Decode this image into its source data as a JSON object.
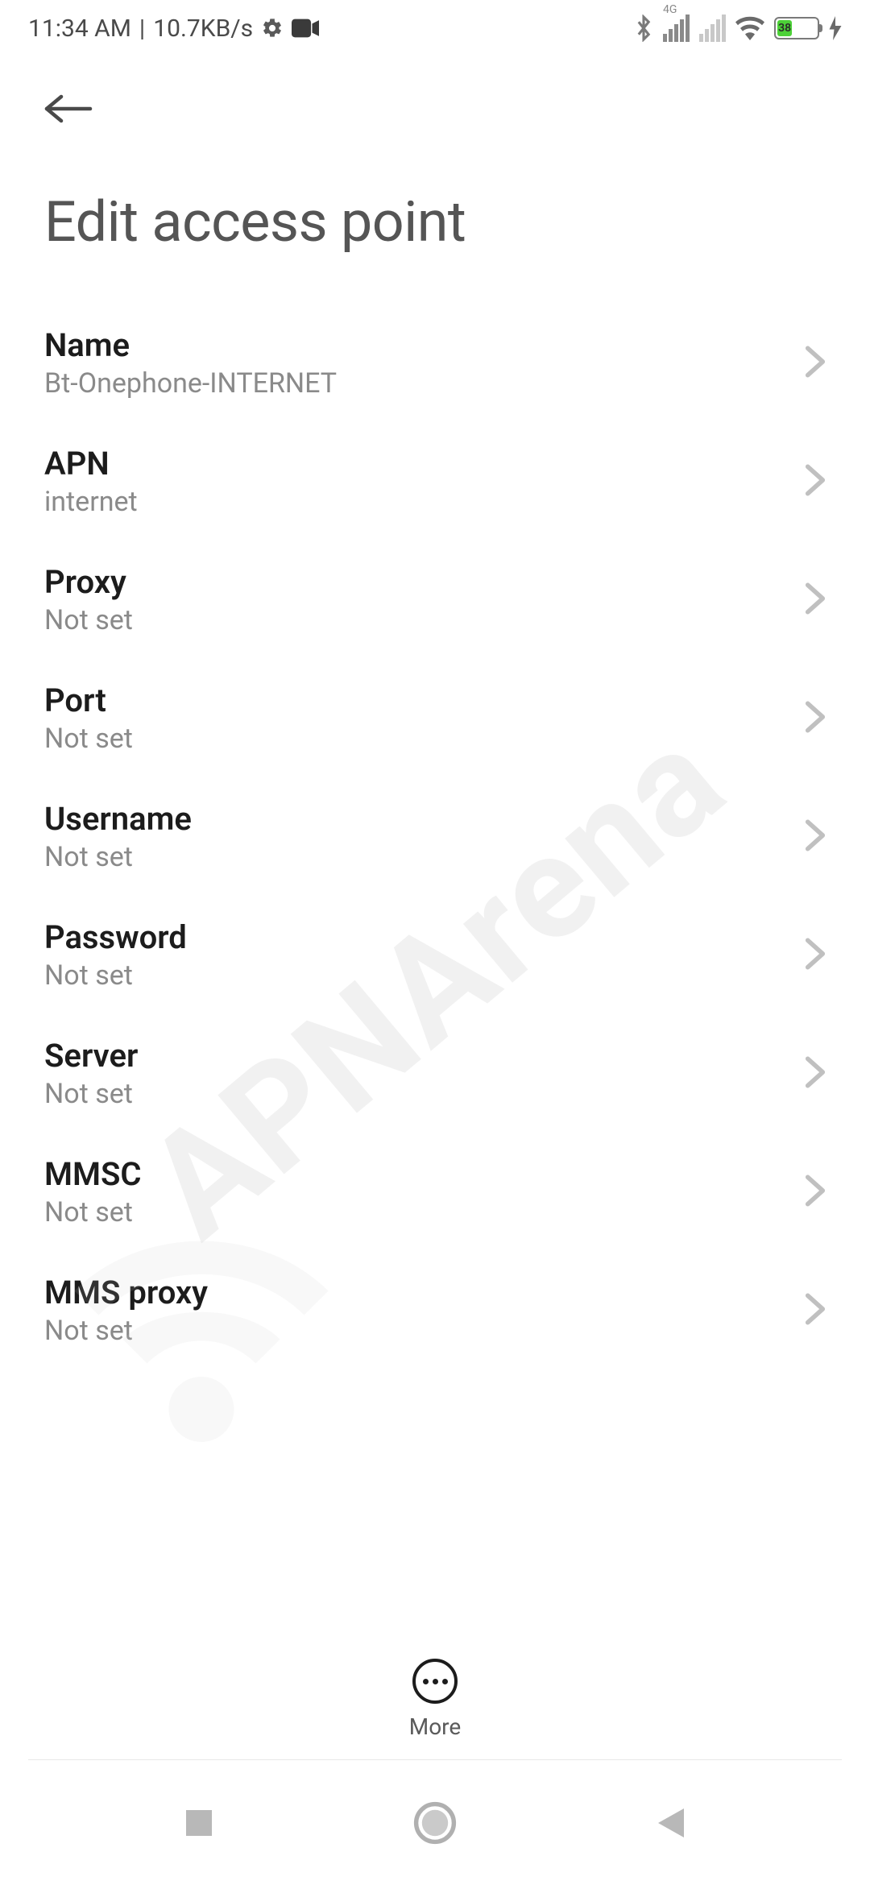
{
  "status": {
    "time": "11:34 AM",
    "speed": "10.7KB/s",
    "network_label": "4G",
    "battery_pct": "38",
    "battery_width": "38%"
  },
  "page_title": "Edit access point",
  "settings": [
    {
      "label": "Name",
      "value": "Bt-Onephone-INTERNET"
    },
    {
      "label": "APN",
      "value": "internet"
    },
    {
      "label": "Proxy",
      "value": "Not set"
    },
    {
      "label": "Port",
      "value": "Not set"
    },
    {
      "label": "Username",
      "value": "Not set"
    },
    {
      "label": "Password",
      "value": "Not set"
    },
    {
      "label": "Server",
      "value": "Not set"
    },
    {
      "label": "MMSC",
      "value": "Not set"
    },
    {
      "label": "MMS proxy",
      "value": "Not set"
    }
  ],
  "more_label": "More",
  "watermark": "APNArena"
}
